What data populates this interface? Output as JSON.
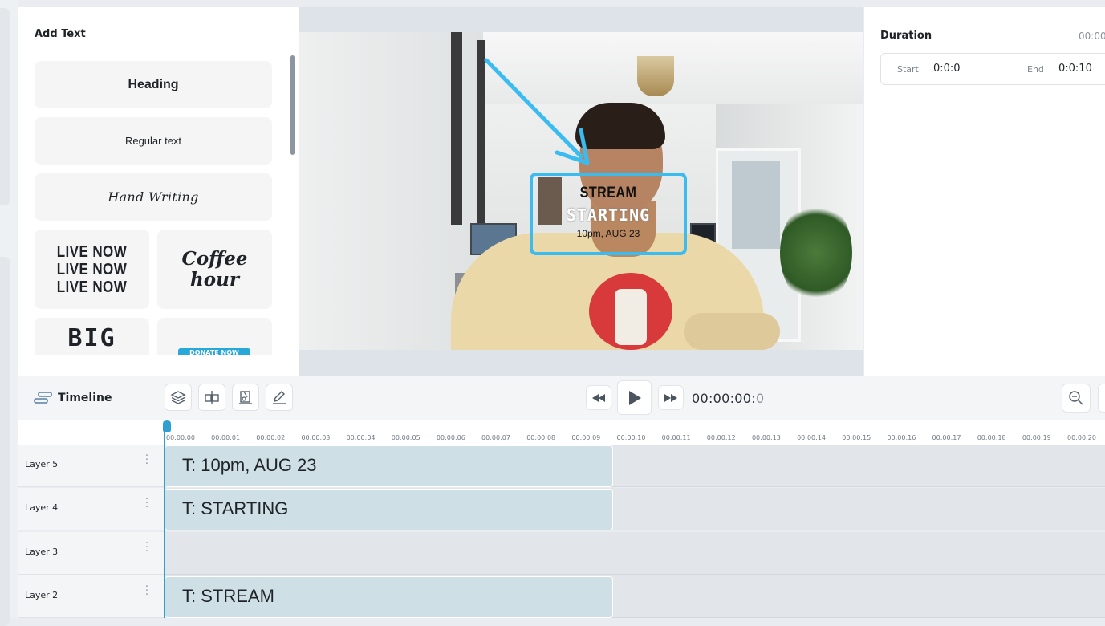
{
  "panel": {
    "title": "Add Text",
    "presets": {
      "heading": "Heading",
      "regular": "Regular text",
      "handwriting": "Hand Writing",
      "live_lines": [
        "LIVE NOW",
        "LIVE NOW",
        "LIVE NOW"
      ],
      "coffee_lines": [
        "Coffee",
        "hour"
      ],
      "big": "BIG",
      "donate": "DONATE NOW"
    }
  },
  "preview": {
    "overlay": {
      "line1": "STREAM",
      "line2": "STARTING",
      "line3": "10pm, AUG 23"
    },
    "arrow_color": "#3bbcf0"
  },
  "duration": {
    "label": "Duration",
    "total": "00:00",
    "start_label": "Start",
    "start_value": "0:0:0",
    "end_label": "End",
    "end_value": "0:0:10"
  },
  "timeline": {
    "label": "Timeline",
    "timecode_main": "00:00:00:",
    "timecode_frame": "0",
    "tools": [
      "layers-icon",
      "split-icon",
      "cut-icon",
      "edit-icon"
    ],
    "ticks": [
      "00:00:00",
      "00:00:01",
      "00:00:02",
      "00:00:03",
      "00:00:04",
      "00:00:05",
      "00:00:06",
      "00:00:07",
      "00:00:08",
      "00:00:09",
      "00:00:10",
      "00:00:11",
      "00:00:12",
      "00:00:13",
      "00:00:14",
      "00:00:15",
      "00:00:16",
      "00:00:17",
      "00:00:18",
      "00:00:19",
      "00:00:20"
    ],
    "layers": [
      {
        "name": "Layer 5",
        "clip": "T: 10pm, AUG 23"
      },
      {
        "name": "Layer 4",
        "clip": "T: STARTING"
      },
      {
        "name": "Layer 3",
        "clip": ""
      },
      {
        "name": "Layer 2",
        "clip": "T: STREAM"
      }
    ]
  },
  "colors": {
    "accent": "#2e9fd1",
    "clip": "#cfdfe6",
    "overlay_border": "#3bbcf0"
  }
}
